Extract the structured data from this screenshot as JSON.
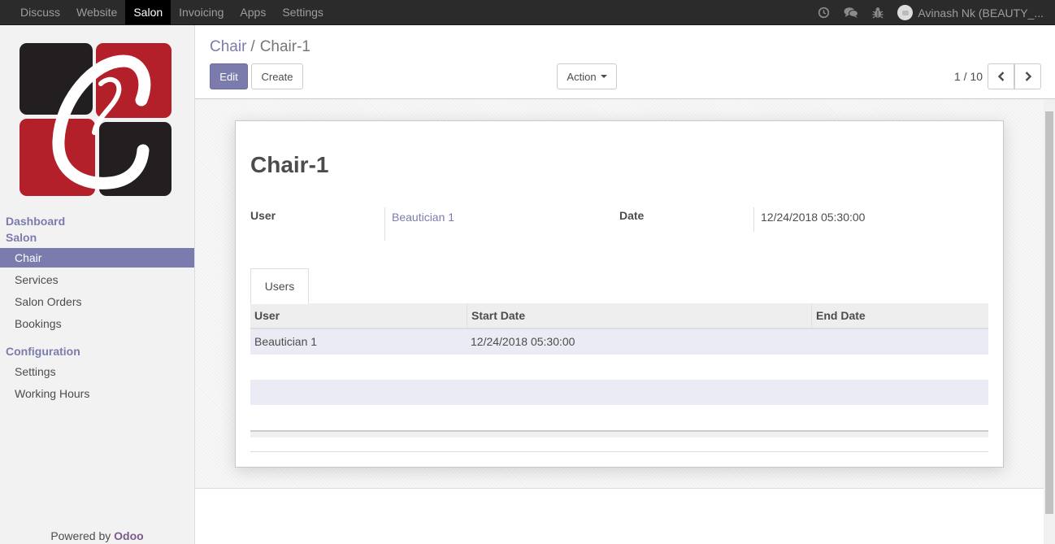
{
  "topbar": {
    "menu": [
      "Discuss",
      "Website",
      "Salon",
      "Invoicing",
      "Apps",
      "Settings"
    ],
    "active": "Salon",
    "user": "Avinash Nk (BEAUTY_..."
  },
  "sidebar": {
    "sections": {
      "dashboard": "Dashboard",
      "salon": "Salon",
      "configuration": "Configuration"
    },
    "salon_items": [
      "Chair",
      "Services",
      "Salon Orders",
      "Bookings"
    ],
    "config_items": [
      "Settings",
      "Working Hours"
    ],
    "powered_prefix": "Powered by ",
    "powered_brand": "Odoo"
  },
  "control_panel": {
    "breadcrumb_parent": "Chair",
    "breadcrumb_sep": "/",
    "breadcrumb_current": "Chair-1",
    "edit_label": "Edit",
    "create_label": "Create",
    "action_label": "Action",
    "pager": "1 / 10"
  },
  "record": {
    "title": "Chair-1",
    "user_label": "User",
    "user_value": "Beautician 1",
    "date_label": "Date",
    "date_value": "12/24/2018 05:30:00",
    "tab_label": "Users",
    "table": {
      "headers": [
        "User",
        "Start Date",
        "End Date"
      ],
      "rows": [
        [
          "Beautician 1",
          "12/24/2018 05:30:00",
          ""
        ]
      ]
    }
  },
  "colors": {
    "brand": "#7c7bad",
    "navbar": "#2b2b2b",
    "logo_red": "#b3202a",
    "logo_dark": "#231f20"
  }
}
